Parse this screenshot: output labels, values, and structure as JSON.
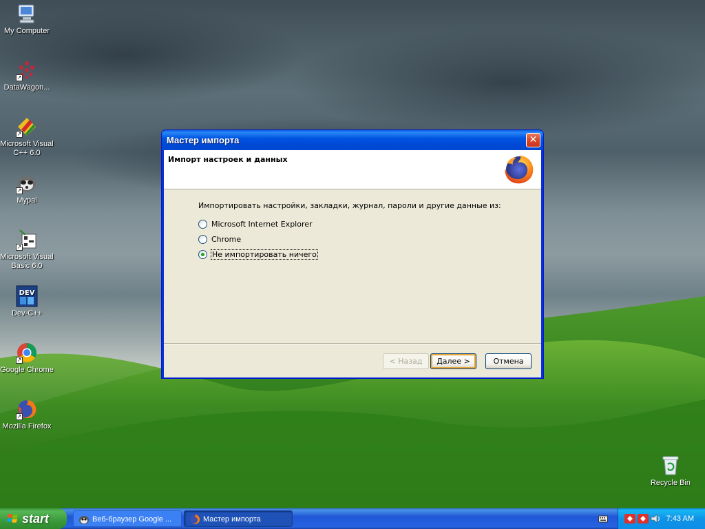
{
  "desktop": {
    "icons": [
      {
        "label": "My Computer",
        "icon": "my-computer-icon"
      },
      {
        "label": "DataWagon...",
        "icon": "datawagon-icon"
      },
      {
        "label": "Microsoft Visual C++ 6.0",
        "icon": "visual-cpp-icon"
      },
      {
        "label": "Mypal",
        "icon": "mypal-icon"
      },
      {
        "label": "Microsoft Visual Basic 6.0",
        "icon": "visual-basic-icon"
      },
      {
        "label": "Dev-C++",
        "icon": "dev-cpp-icon"
      },
      {
        "label": "Google Chrome",
        "icon": "chrome-icon"
      },
      {
        "label": "Mozilla Firefox",
        "icon": "firefox-icon"
      },
      {
        "label": "Recycle Bin",
        "icon": "recycle-bin-icon"
      }
    ]
  },
  "dialog": {
    "title": "Мастер импорта",
    "heading": "Импорт настроек и данных",
    "prompt": "Импортировать настройки, закладки, журнал, пароли и другие данные из:",
    "options": [
      {
        "label": "Microsoft Internet Explorer",
        "checked": false
      },
      {
        "label": "Chrome",
        "checked": false
      },
      {
        "label": "Не импортировать ничего",
        "checked": true
      }
    ],
    "buttons": {
      "back": "< Назад",
      "next": "Далее >",
      "cancel": "Отмена"
    }
  },
  "taskbar": {
    "start_label": "start",
    "tasks": [
      {
        "label": "Веб-браузер Google ...",
        "icon": "chrome-icon",
        "active": false
      },
      {
        "label": "Мастер импорта",
        "icon": "firefox-icon",
        "active": true
      }
    ],
    "clock": "7:43 AM"
  },
  "colors": {
    "title_bar": "#0054e3",
    "start_button": "#3c9a3c",
    "tray": "#0c8ee7",
    "dialog_face": "#ece9d8"
  }
}
